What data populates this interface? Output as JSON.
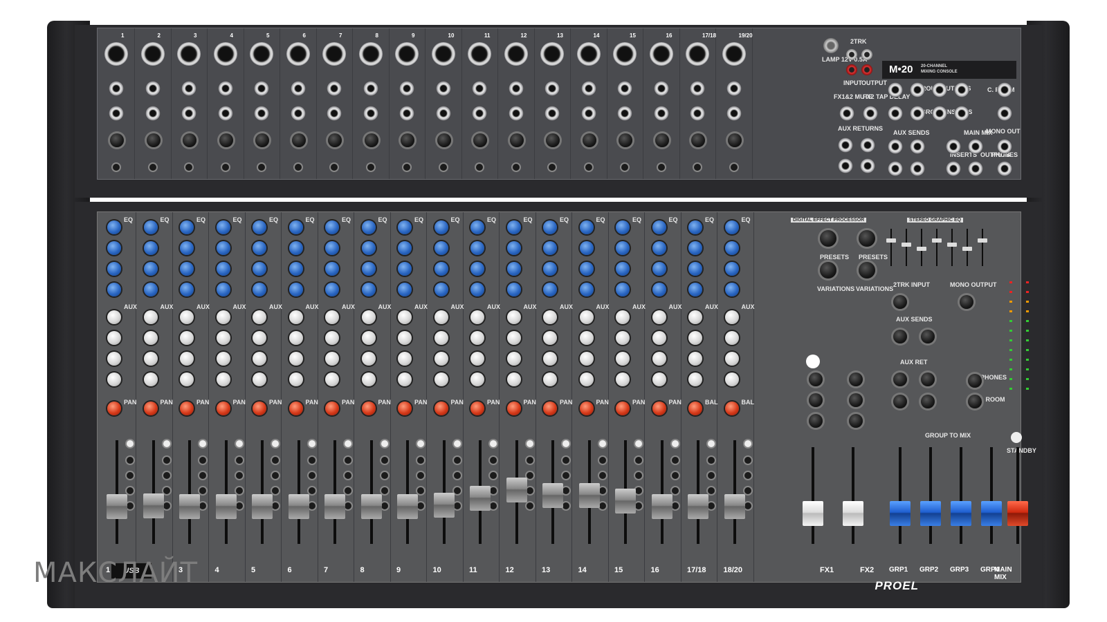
{
  "brand": "PROEL",
  "watermark": "МАКСЛАЙТ",
  "usb_label": "USB",
  "model": {
    "name": "M•20",
    "subtitle_line1": "20-CHANNEL",
    "subtitle_line2": "MIXING CONSOLE"
  },
  "rear_panel": {
    "channel_numbers": [
      "1",
      "2",
      "3",
      "4",
      "5",
      "6",
      "7",
      "8",
      "9",
      "10",
      "11",
      "12",
      "13",
      "14",
      "15",
      "16",
      "17/18",
      "19/20"
    ],
    "section_labels": {
      "lamp": "LAMP 12V 0.5A",
      "twotrk": "2TRK",
      "input": "INPUT",
      "output": "OUTPUT",
      "fx_mute": "FX1&2 MUTE",
      "fx2_tap": "FX2 TAP DELAY",
      "aux_returns": "AUX RETURNS",
      "group_outputs": "GROUP OUTPUTS",
      "group_inserts": "GROUP INSERTS",
      "aux_sends": "AUX SENDS",
      "main_mix": "MAIN MIX",
      "inserts": "INSERTS",
      "outputs": "OUTPUTS",
      "c_room": "C. ROOM",
      "mono_out": "MONO OUT",
      "phones": "PHONES"
    }
  },
  "front_panel": {
    "section_labels": {
      "digital_effect_processor": "DIGITAL EFFECT PROCESSOR",
      "stereo_graphic_eq": "STEREO GRAPHIC EQ",
      "twotrk_input": "2TRK INPUT",
      "mono_output": "MONO OUTPUT",
      "aux_sends": "AUX SENDS",
      "aux_ret": "AUX RET",
      "phones": "PHONES",
      "c_room": "C. ROOM",
      "group_to_mix": "GROUP TO MIX",
      "standby": "STANDBY",
      "eq": "EQ",
      "aux": "AUX",
      "pan": "PAN",
      "bal": "BAL",
      "presets": "PRESETS",
      "variations": "VARIATIONS"
    },
    "bottom_labels": [
      "1",
      "2",
      "3",
      "4",
      "5",
      "6",
      "7",
      "8",
      "9",
      "10",
      "11",
      "12",
      "13",
      "14",
      "15",
      "16",
      "17/18",
      "18/20",
      "FX1",
      "FX2",
      "GRP1",
      "GRP2",
      "GRP3",
      "GRP4",
      "MAIN MIX"
    ]
  },
  "fader_levels": [
    0.35,
    0.36,
    0.35,
    0.35,
    0.35,
    0.35,
    0.35,
    0.35,
    0.35,
    0.37,
    0.45,
    0.55,
    0.48,
    0.48,
    0.42,
    0.35,
    0.35,
    0.35,
    0.35,
    0.35,
    0.35,
    0.35,
    0.35,
    0.35,
    0.35
  ],
  "colors": {
    "eq_knob": "#2a66c2",
    "aux_knob": "#d8d8d8",
    "pan_knob": "#d63a1a",
    "fx_fader": "#f4f4f4",
    "group_fader": "#1f5fd0",
    "main_fader": "#d02a10"
  }
}
